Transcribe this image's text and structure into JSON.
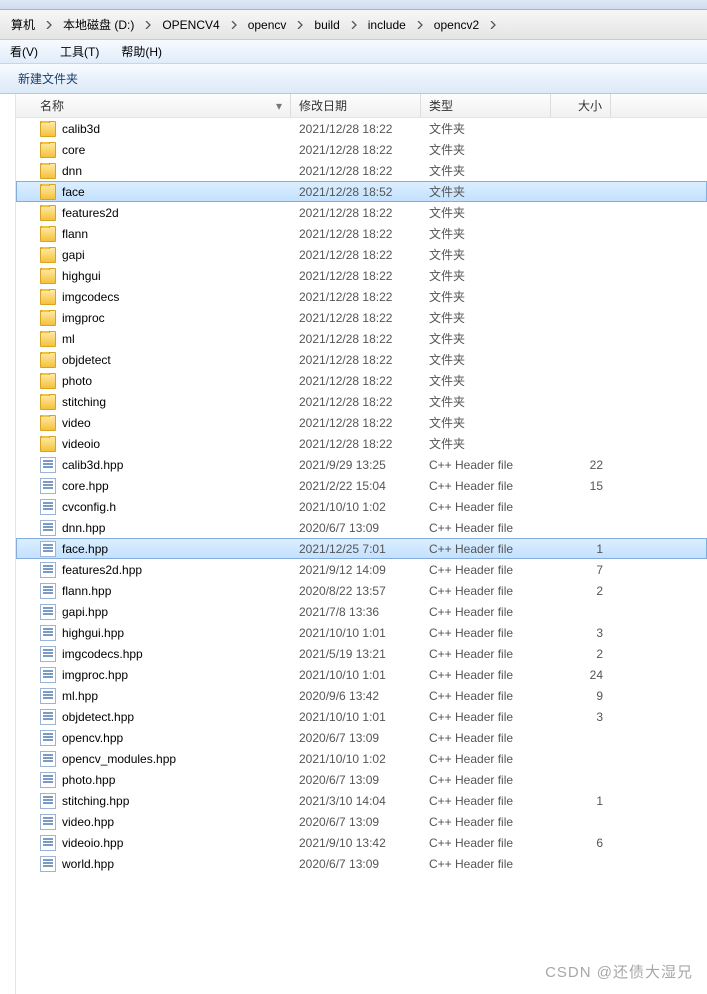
{
  "breadcrumb": [
    {
      "label": "算机"
    },
    {
      "label": "本地磁盘 (D:)"
    },
    {
      "label": "OPENCV4"
    },
    {
      "label": "opencv"
    },
    {
      "label": "build"
    },
    {
      "label": "include"
    },
    {
      "label": "opencv2"
    }
  ],
  "menu": {
    "view": "看(V)",
    "tools": "工具(T)",
    "help": "帮助(H)"
  },
  "toolbar": {
    "new_folder": "新建文件夹"
  },
  "columns": {
    "name": "名称",
    "date": "修改日期",
    "type": "类型",
    "size": "大小"
  },
  "type_labels": {
    "folder": "文件夹",
    "header": "C++ Header file"
  },
  "rows": [
    {
      "icon": "folder",
      "name": "calib3d",
      "date": "2021/12/28 18:22",
      "type": "folder",
      "size": ""
    },
    {
      "icon": "folder",
      "name": "core",
      "date": "2021/12/28 18:22",
      "type": "folder",
      "size": ""
    },
    {
      "icon": "folder",
      "name": "dnn",
      "date": "2021/12/28 18:22",
      "type": "folder",
      "size": ""
    },
    {
      "icon": "folder",
      "name": "face",
      "date": "2021/12/28 18:52",
      "type": "folder",
      "size": "",
      "selected": true
    },
    {
      "icon": "folder",
      "name": "features2d",
      "date": "2021/12/28 18:22",
      "type": "folder",
      "size": ""
    },
    {
      "icon": "folder",
      "name": "flann",
      "date": "2021/12/28 18:22",
      "type": "folder",
      "size": ""
    },
    {
      "icon": "folder",
      "name": "gapi",
      "date": "2021/12/28 18:22",
      "type": "folder",
      "size": ""
    },
    {
      "icon": "folder",
      "name": "highgui",
      "date": "2021/12/28 18:22",
      "type": "folder",
      "size": ""
    },
    {
      "icon": "folder",
      "name": "imgcodecs",
      "date": "2021/12/28 18:22",
      "type": "folder",
      "size": ""
    },
    {
      "icon": "folder",
      "name": "imgproc",
      "date": "2021/12/28 18:22",
      "type": "folder",
      "size": ""
    },
    {
      "icon": "folder",
      "name": "ml",
      "date": "2021/12/28 18:22",
      "type": "folder",
      "size": ""
    },
    {
      "icon": "folder",
      "name": "objdetect",
      "date": "2021/12/28 18:22",
      "type": "folder",
      "size": ""
    },
    {
      "icon": "folder",
      "name": "photo",
      "date": "2021/12/28 18:22",
      "type": "folder",
      "size": ""
    },
    {
      "icon": "folder",
      "name": "stitching",
      "date": "2021/12/28 18:22",
      "type": "folder",
      "size": ""
    },
    {
      "icon": "folder",
      "name": "video",
      "date": "2021/12/28 18:22",
      "type": "folder",
      "size": ""
    },
    {
      "icon": "folder",
      "name": "videoio",
      "date": "2021/12/28 18:22",
      "type": "folder",
      "size": ""
    },
    {
      "icon": "file",
      "name": "calib3d.hpp",
      "date": "2021/9/29 13:25",
      "type": "header",
      "size": "22"
    },
    {
      "icon": "file",
      "name": "core.hpp",
      "date": "2021/2/22 15:04",
      "type": "header",
      "size": "15"
    },
    {
      "icon": "file",
      "name": "cvconfig.h",
      "date": "2021/10/10 1:02",
      "type": "header",
      "size": ""
    },
    {
      "icon": "file",
      "name": "dnn.hpp",
      "date": "2020/6/7 13:09",
      "type": "header",
      "size": ""
    },
    {
      "icon": "file",
      "name": "face.hpp",
      "date": "2021/12/25 7:01",
      "type": "header",
      "size": "1",
      "selected": true
    },
    {
      "icon": "file",
      "name": "features2d.hpp",
      "date": "2021/9/12 14:09",
      "type": "header",
      "size": "7"
    },
    {
      "icon": "file",
      "name": "flann.hpp",
      "date": "2020/8/22 13:57",
      "type": "header",
      "size": "2"
    },
    {
      "icon": "file",
      "name": "gapi.hpp",
      "date": "2021/7/8 13:36",
      "type": "header",
      "size": ""
    },
    {
      "icon": "file",
      "name": "highgui.hpp",
      "date": "2021/10/10 1:01",
      "type": "header",
      "size": "3"
    },
    {
      "icon": "file",
      "name": "imgcodecs.hpp",
      "date": "2021/5/19 13:21",
      "type": "header",
      "size": "2"
    },
    {
      "icon": "file",
      "name": "imgproc.hpp",
      "date": "2021/10/10 1:01",
      "type": "header",
      "size": "24"
    },
    {
      "icon": "file",
      "name": "ml.hpp",
      "date": "2020/9/6 13:42",
      "type": "header",
      "size": "9"
    },
    {
      "icon": "file",
      "name": "objdetect.hpp",
      "date": "2021/10/10 1:01",
      "type": "header",
      "size": "3"
    },
    {
      "icon": "file",
      "name": "opencv.hpp",
      "date": "2020/6/7 13:09",
      "type": "header",
      "size": ""
    },
    {
      "icon": "file",
      "name": "opencv_modules.hpp",
      "date": "2021/10/10 1:02",
      "type": "header",
      "size": ""
    },
    {
      "icon": "file",
      "name": "photo.hpp",
      "date": "2020/6/7 13:09",
      "type": "header",
      "size": ""
    },
    {
      "icon": "file",
      "name": "stitching.hpp",
      "date": "2021/3/10 14:04",
      "type": "header",
      "size": "1"
    },
    {
      "icon": "file",
      "name": "video.hpp",
      "date": "2020/6/7 13:09",
      "type": "header",
      "size": ""
    },
    {
      "icon": "file",
      "name": "videoio.hpp",
      "date": "2021/9/10 13:42",
      "type": "header",
      "size": "6"
    },
    {
      "icon": "file",
      "name": "world.hpp",
      "date": "2020/6/7 13:09",
      "type": "header",
      "size": ""
    }
  ],
  "watermark": "CSDN @还债大湿兄"
}
